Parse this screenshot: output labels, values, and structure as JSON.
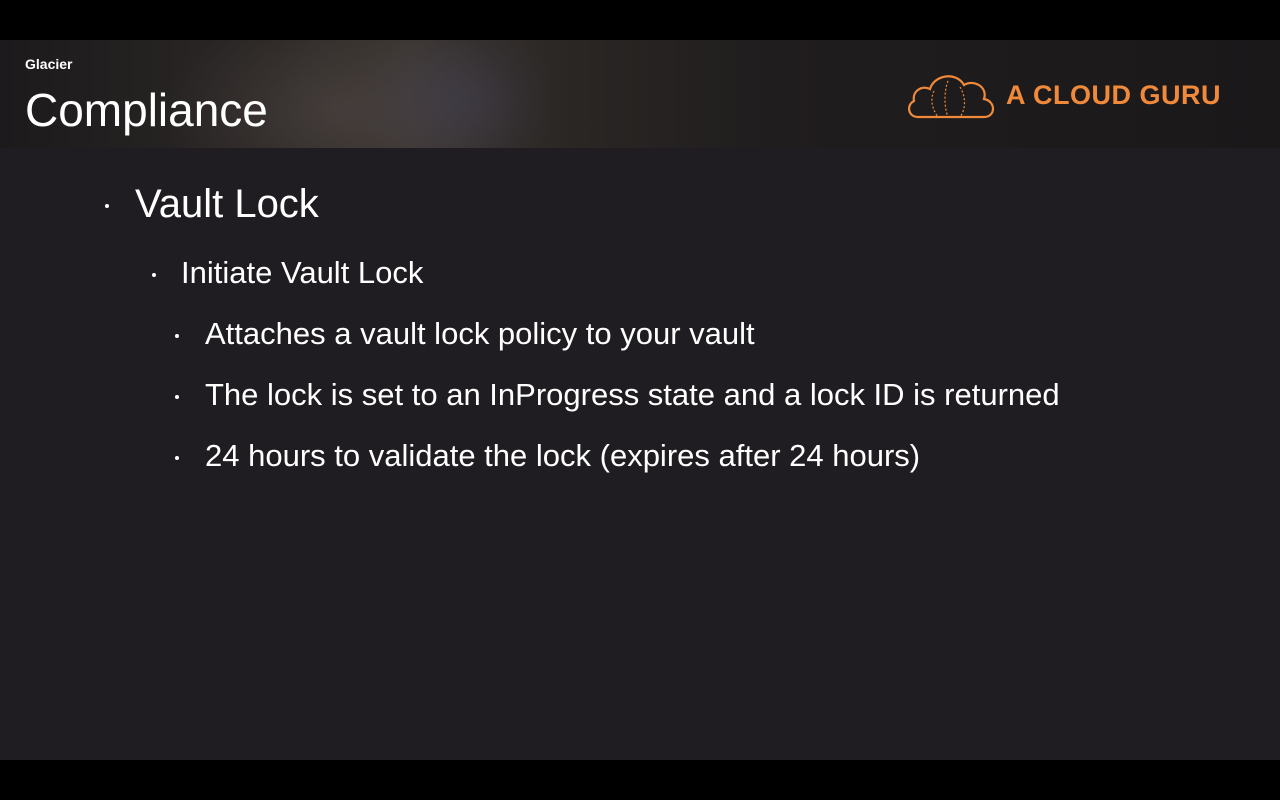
{
  "header": {
    "section_label": "Glacier",
    "title": "Compliance",
    "logo_text": "A CLOUD GURU"
  },
  "bullets": {
    "level1": "Vault Lock",
    "level2": "Initiate Vault Lock",
    "level3": [
      "Attaches a vault lock policy to your vault",
      "The lock is set to an InProgress state and a lock ID is returned",
      "24 hours to validate the lock (expires after 24 hours)"
    ]
  },
  "colors": {
    "background": "#1f1d21",
    "text": "#ffffff",
    "brand": "#f08a3a"
  }
}
